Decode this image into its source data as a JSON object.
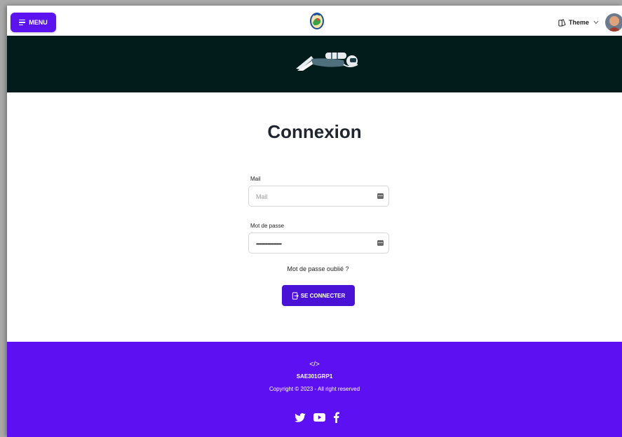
{
  "header": {
    "menu_label": "MENU",
    "theme_label": "Theme"
  },
  "login": {
    "title": "Connexion",
    "mail_label": "Mail",
    "mail_placeholder": "Mail",
    "password_label": "Mot de passe",
    "password_value": "••••••••••••••••••••",
    "forgot_label": "Mot de passe oublié ?",
    "submit_label": "SE CONNECTER"
  },
  "footer": {
    "code_glyph": "</>",
    "brand": "SAE301GRP1",
    "copyright": "Copyright © 2023 - All right reserved"
  },
  "icons": {
    "menu": "hamburger-icon",
    "theme": "palette-icon",
    "chevron": "chevron-down-icon",
    "field": "keyboard-icon",
    "login": "login-icon",
    "twitter": "twitter-icon",
    "youtube": "youtube-icon",
    "facebook": "facebook-icon"
  },
  "colors": {
    "primary": "#5b13ef",
    "banner": "#021c1c",
    "footer": "#5d11f2",
    "title": "#1f2630"
  }
}
